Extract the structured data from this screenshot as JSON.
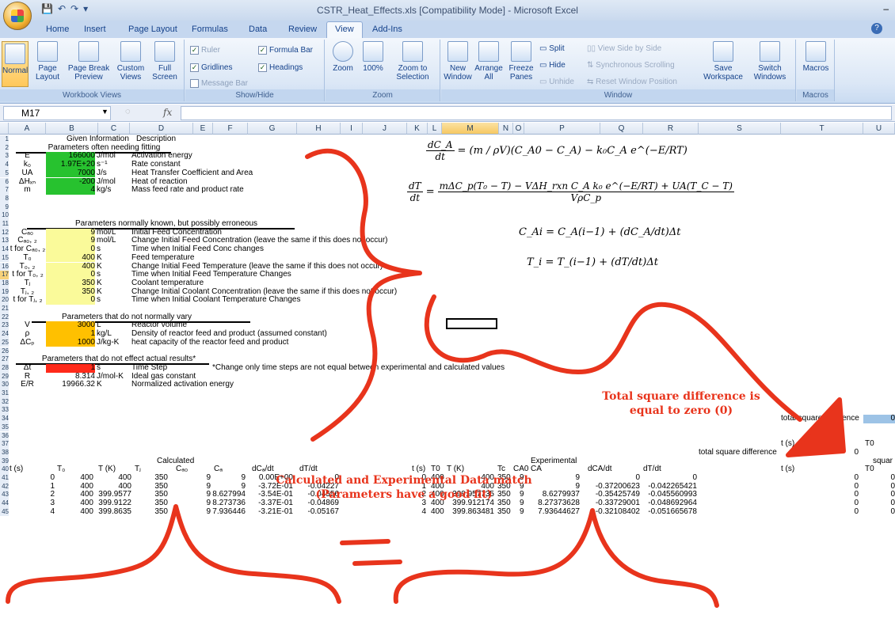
{
  "window": {
    "title": "CSTR_Heat_Effects.xls  [Compatibility Mode] - Microsoft Excel",
    "minimize": "–"
  },
  "ribbon": {
    "tabs": [
      "Home",
      "Insert",
      "Page Layout",
      "Formulas",
      "Data",
      "Review",
      "View",
      "Add-Ins"
    ],
    "active_tab": "View",
    "groups": {
      "workbook_views": {
        "label": "Workbook Views",
        "normal": "Normal",
        "page_layout": "Page Layout",
        "page_break_preview": "Page Break Preview",
        "custom_views": "Custom Views",
        "full_screen": "Full Screen"
      },
      "show_hide": {
        "label": "Show/Hide",
        "ruler": "Ruler",
        "gridlines": "Gridlines",
        "message_bar": "Message Bar",
        "formula_bar": "Formula Bar",
        "headings": "Headings"
      },
      "zoom": {
        "label": "Zoom",
        "zoom": "Zoom",
        "hundred": "100%",
        "zoom_to_selection": "Zoom to Selection"
      },
      "window": {
        "label": "Window",
        "new_window": "New Window",
        "arrange_all": "Arrange All",
        "freeze_panes": "Freeze Panes",
        "split": "Split",
        "hide": "Hide",
        "unhide": "Unhide",
        "view_side_by_side": "View Side by Side",
        "sync_scrolling": "Synchronous Scrolling",
        "reset_window_position": "Reset Window Position",
        "save_workspace": "Save Workspace",
        "switch_windows": "Switch Windows"
      },
      "macros": {
        "label": "Macros",
        "macros": "Macros"
      }
    }
  },
  "formula_bar": {
    "name_box": "M17",
    "fx": "fx",
    "value": ""
  },
  "columns": [
    "A",
    "B",
    "C",
    "D",
    "E",
    "F",
    "G",
    "H",
    "I",
    "J",
    "K",
    "L",
    "M",
    "N",
    "O",
    "P",
    "Q",
    "R",
    "S",
    "T",
    "U"
  ],
  "selected_column": "M",
  "selected_row": "17",
  "rows": [
    "1",
    "2",
    "3",
    "4",
    "5",
    "6",
    "7",
    "8",
    "9",
    "10",
    "11",
    "12",
    "13",
    "14",
    "15",
    "16",
    "17",
    "18",
    "19",
    "20",
    "21",
    "22",
    "23",
    "24",
    "25",
    "26",
    "27",
    "28",
    "29",
    "30",
    "31",
    "32",
    "33",
    "34",
    "35",
    "36",
    "37",
    "38",
    "39",
    "40",
    "41",
    "42",
    "43",
    "44",
    "45"
  ],
  "sheet": {
    "given_information": "Given Information",
    "description": "Description",
    "section1_title": "Parameters often needing fitting",
    "section1": [
      {
        "name": "E",
        "value": "166000",
        "unit": "J/mol",
        "desc": "Activation energy"
      },
      {
        "name": "k₀",
        "value": "1.97E+20",
        "unit": "s⁻¹",
        "desc": "Rate constant"
      },
      {
        "name": "UA",
        "value": "7000",
        "unit": "J/s",
        "desc": "Heat Transfer Coefficient and Area"
      },
      {
        "name": "ΔHₓₙ",
        "value": "-200",
        "unit": "J/mol",
        "desc": "Heat of reaction"
      },
      {
        "name": "m",
        "value": "4",
        "unit": "kg/s",
        "desc": "Mass feed rate and product rate"
      }
    ],
    "section2_title": "Parameters normally known, but possibly erroneous",
    "section2": [
      {
        "name": "Cₐ₀",
        "value": "9",
        "unit": "mol/L",
        "desc": "Initial Feed Concentration"
      },
      {
        "name": "Cₐ₀, ₂",
        "value": "9",
        "unit": "mol/L",
        "desc": "Change Initial Feed Concentration (leave the same if this does not occur)"
      },
      {
        "name": "t for Cₐ₀, ₂",
        "value": "0",
        "unit": "s",
        "desc": "Time when Initial Feed Conc changes"
      },
      {
        "name": "T₀",
        "value": "400",
        "unit": "K",
        "desc": "Feed temperature"
      },
      {
        "name": "T₀, ₂",
        "value": "400",
        "unit": "K",
        "desc": "Change Initial Feed Temperature (leave the same if this does not occur)"
      },
      {
        "name": "t for T₀, ₂",
        "value": "0",
        "unit": "s",
        "desc": "Time when Initial Feed Temperature Changes"
      },
      {
        "name": "Tⱼ",
        "value": "350",
        "unit": "K",
        "desc": "Coolant temperature"
      },
      {
        "name": "Tⱼ, ₂",
        "value": "350",
        "unit": "K",
        "desc": "Change Initial Coolant Concentration (leave the same if this does not occur)"
      },
      {
        "name": "t for Tⱼ, ₂",
        "value": "0",
        "unit": "s",
        "desc": "Time when Initial Coolant Temperature Changes"
      }
    ],
    "section3_title": "Parameters that do not normally vary",
    "section3": [
      {
        "name": "V",
        "value": "3000",
        "unit": "L",
        "desc": "Reactor volume"
      },
      {
        "name": "ρ",
        "value": "1",
        "unit": "kg/L",
        "desc": "Density of reactor feed and product (assumed constant)"
      },
      {
        "name": "ΔCₚ",
        "value": "1000",
        "unit": "J/kg-K",
        "desc": "heat capacity of the reactor feed and product"
      }
    ],
    "section4_title": "Parameters that do not effect actual results*",
    "section4": [
      {
        "name": "Δt",
        "value": "1",
        "unit": "s",
        "desc": "Time Step"
      },
      {
        "name": "R",
        "value": "8.314",
        "unit": "J/mol-K",
        "desc": "Ideal gas constant"
      },
      {
        "name": "E/R",
        "value": "19966.32",
        "unit": "K",
        "desc": "Normalized activation energy"
      }
    ],
    "note": "*Change only time steps are not equal between experimental and calculated values",
    "total_sq_label": "total square difference",
    "total_sq_value": "0",
    "t_s_label": "t (s)",
    "t0_label": "T0",
    "total_sq_value2": "0",
    "squar_label": "squar",
    "calculated_title": "Calculated",
    "experimental_title": "Experimental",
    "calc_headers": [
      "t (s)",
      "T₀",
      "T (K)",
      "Tⱼ",
      "Cₐ₀",
      "Cₐ",
      "dCₐ/dt",
      "dT/dt"
    ],
    "calc_rows": [
      [
        "0",
        "400",
        "400",
        "350",
        "9",
        "9",
        "0.00E+00",
        "0"
      ],
      [
        "1",
        "400",
        "400",
        "350",
        "9",
        "9",
        "-3.72E-01",
        "-0.04227"
      ],
      [
        "2",
        "400",
        "399.9577",
        "350",
        "9",
        "8.627994",
        "-3.54E-01",
        "-0.04556"
      ],
      [
        "3",
        "400",
        "399.9122",
        "350",
        "9",
        "8.273736",
        "-3.37E-01",
        "-0.04869"
      ],
      [
        "4",
        "400",
        "399.8635",
        "350",
        "9",
        "7.936446",
        "-3.21E-01",
        "-0.05167"
      ]
    ],
    "exp_headers": [
      "t (s)",
      "T0",
      "T (K)",
      "Tc",
      "CA0",
      "CA",
      "dCA/dt",
      "dT/dt"
    ],
    "exp_rows": [
      [
        "0",
        "400",
        "400",
        "350",
        "9",
        "9",
        "0",
        "0"
      ],
      [
        "1",
        "400",
        "400",
        "350",
        "9",
        "9",
        "-0.37200623",
        "-0.042265421"
      ],
      [
        "2",
        "400",
        "399.957735",
        "350",
        "9",
        "8.6279937",
        "-0.35425749",
        "-0.045560993"
      ],
      [
        "3",
        "400",
        "399.912174",
        "350",
        "9",
        "8.27373628",
        "-0.33729001",
        "-0.048692964"
      ],
      [
        "4",
        "400",
        "399.863481",
        "350",
        "9",
        "7.93644627",
        "-0.32108402",
        "-0.051665678"
      ]
    ],
    "right_headers": [
      "t (s)",
      "T0"
    ],
    "right_rows": [
      [
        "0",
        "0"
      ],
      [
        "0",
        "0"
      ],
      [
        "0",
        "0"
      ],
      [
        "0",
        "0"
      ],
      [
        "0",
        "0"
      ]
    ]
  },
  "equations": {
    "eq1_lhs_num": "dC_A",
    "eq1_lhs_den": "dt",
    "eq1_rhs": "= (m / ρV)(C_A0 − C_A) − k₀C_A e^(−E/RT)",
    "eq2_num": "mΔC_p(T₀ − T) − VΔH_rxn C_A k₀ e^(−E/RT) + UA(T_C − T)",
    "eq2_den": "VρC_p",
    "eq2_lhs_num": "dT",
    "eq2_lhs_den": "dt",
    "eq3": "C_Ai = C_A(i−1) + (dC_A/dt)Δt",
    "eq4": "T_i = T_(i−1) + (dT/dt)Δt"
  },
  "annotations": {
    "total_sq_text": "Total square difference is equal to zero (0)",
    "match_text_1": "Calculated and Experimental Data match",
    "match_text_2": "(Parameters have a good fit)",
    "scribble_color": "#e8341c"
  }
}
